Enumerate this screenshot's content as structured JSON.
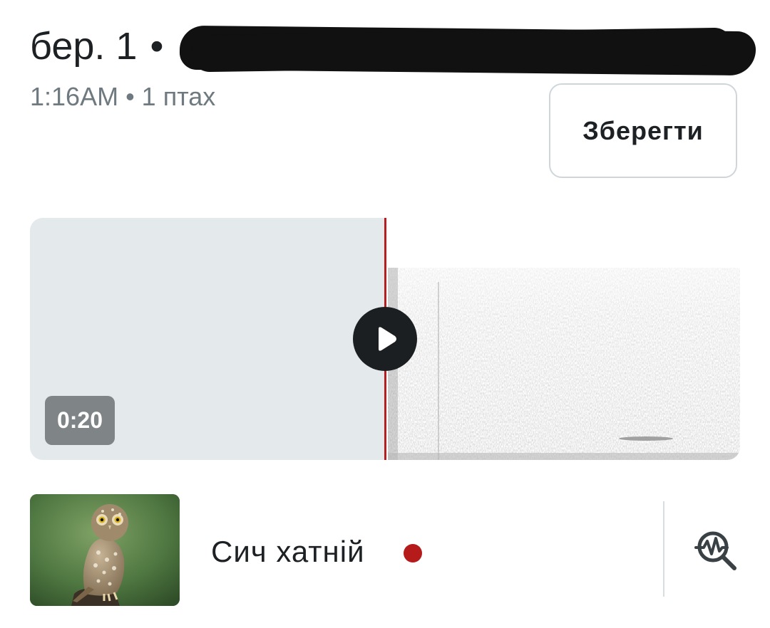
{
  "header": {
    "date": "бер. 1",
    "separator": "•",
    "subtitle": "1:16AM • 1 птах"
  },
  "actions": {
    "save_label": "Зберегти"
  },
  "player": {
    "elapsed": "0:20",
    "progress": 0.5,
    "played_color": "#e4e9eb",
    "playhead_color": "#b3201f"
  },
  "species": {
    "name": "Сич хатній",
    "status_color": "#b51b1b",
    "thumbnail_icon": "little-owl-photo",
    "analyze_icon": "spectrogram-search-icon"
  }
}
